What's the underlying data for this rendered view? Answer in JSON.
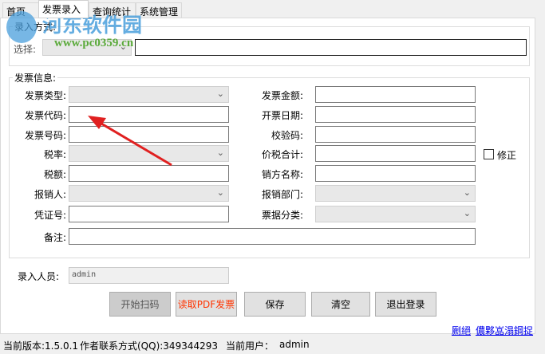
{
  "tabs": [
    {
      "label": "首页"
    },
    {
      "label": "发票录入"
    },
    {
      "label": "查询统计"
    },
    {
      "label": "系统管理"
    }
  ],
  "entry_mode": {
    "group_label": "录入方式:",
    "select_label": "选择:",
    "select_value": "",
    "input_value": ""
  },
  "invoice": {
    "group_label": "发票信息:",
    "left": [
      {
        "label": "发票类型:",
        "type": "select"
      },
      {
        "label": "发票代码:",
        "type": "input"
      },
      {
        "label": "发票号码:",
        "type": "input"
      },
      {
        "label": "税率:",
        "type": "select"
      },
      {
        "label": "税额:",
        "type": "input"
      },
      {
        "label": "报销人:",
        "type": "select"
      },
      {
        "label": "凭证号:",
        "type": "input"
      }
    ],
    "right": [
      {
        "label": "发票金额:",
        "type": "input"
      },
      {
        "label": "开票日期:",
        "type": "input"
      },
      {
        "label": "校验码:",
        "type": "input"
      },
      {
        "label": "价税合计:",
        "type": "input"
      },
      {
        "label": "销方名称:",
        "type": "input"
      },
      {
        "label": "报销部门:",
        "type": "select"
      },
      {
        "label": "票据分类:",
        "type": "select"
      }
    ],
    "remark_label": "备注:",
    "correction_label": "修正",
    "correction_checked": false
  },
  "operator": {
    "label": "录入人员:",
    "value": "admin"
  },
  "buttons": {
    "scan": "开始扫码",
    "read_pdf": "读取PDF发票",
    "save": "保存",
    "clear": "清空",
    "logout": "退出登录"
  },
  "links": [
    "劂絕",
    "儂夥嵓溻鋼捉"
  ],
  "status": {
    "version": "当前版本:1.5.0.1",
    "contact": "作者联系方式(QQ):349344293",
    "user_label": "当前用户：",
    "user": "admin"
  },
  "watermark": {
    "title": "河东软件园",
    "url": "www.pc0359.cn"
  },
  "colors": {
    "pdf_button_text": "#ff3300",
    "arrow": "#e02020",
    "link": "#0000ee"
  }
}
